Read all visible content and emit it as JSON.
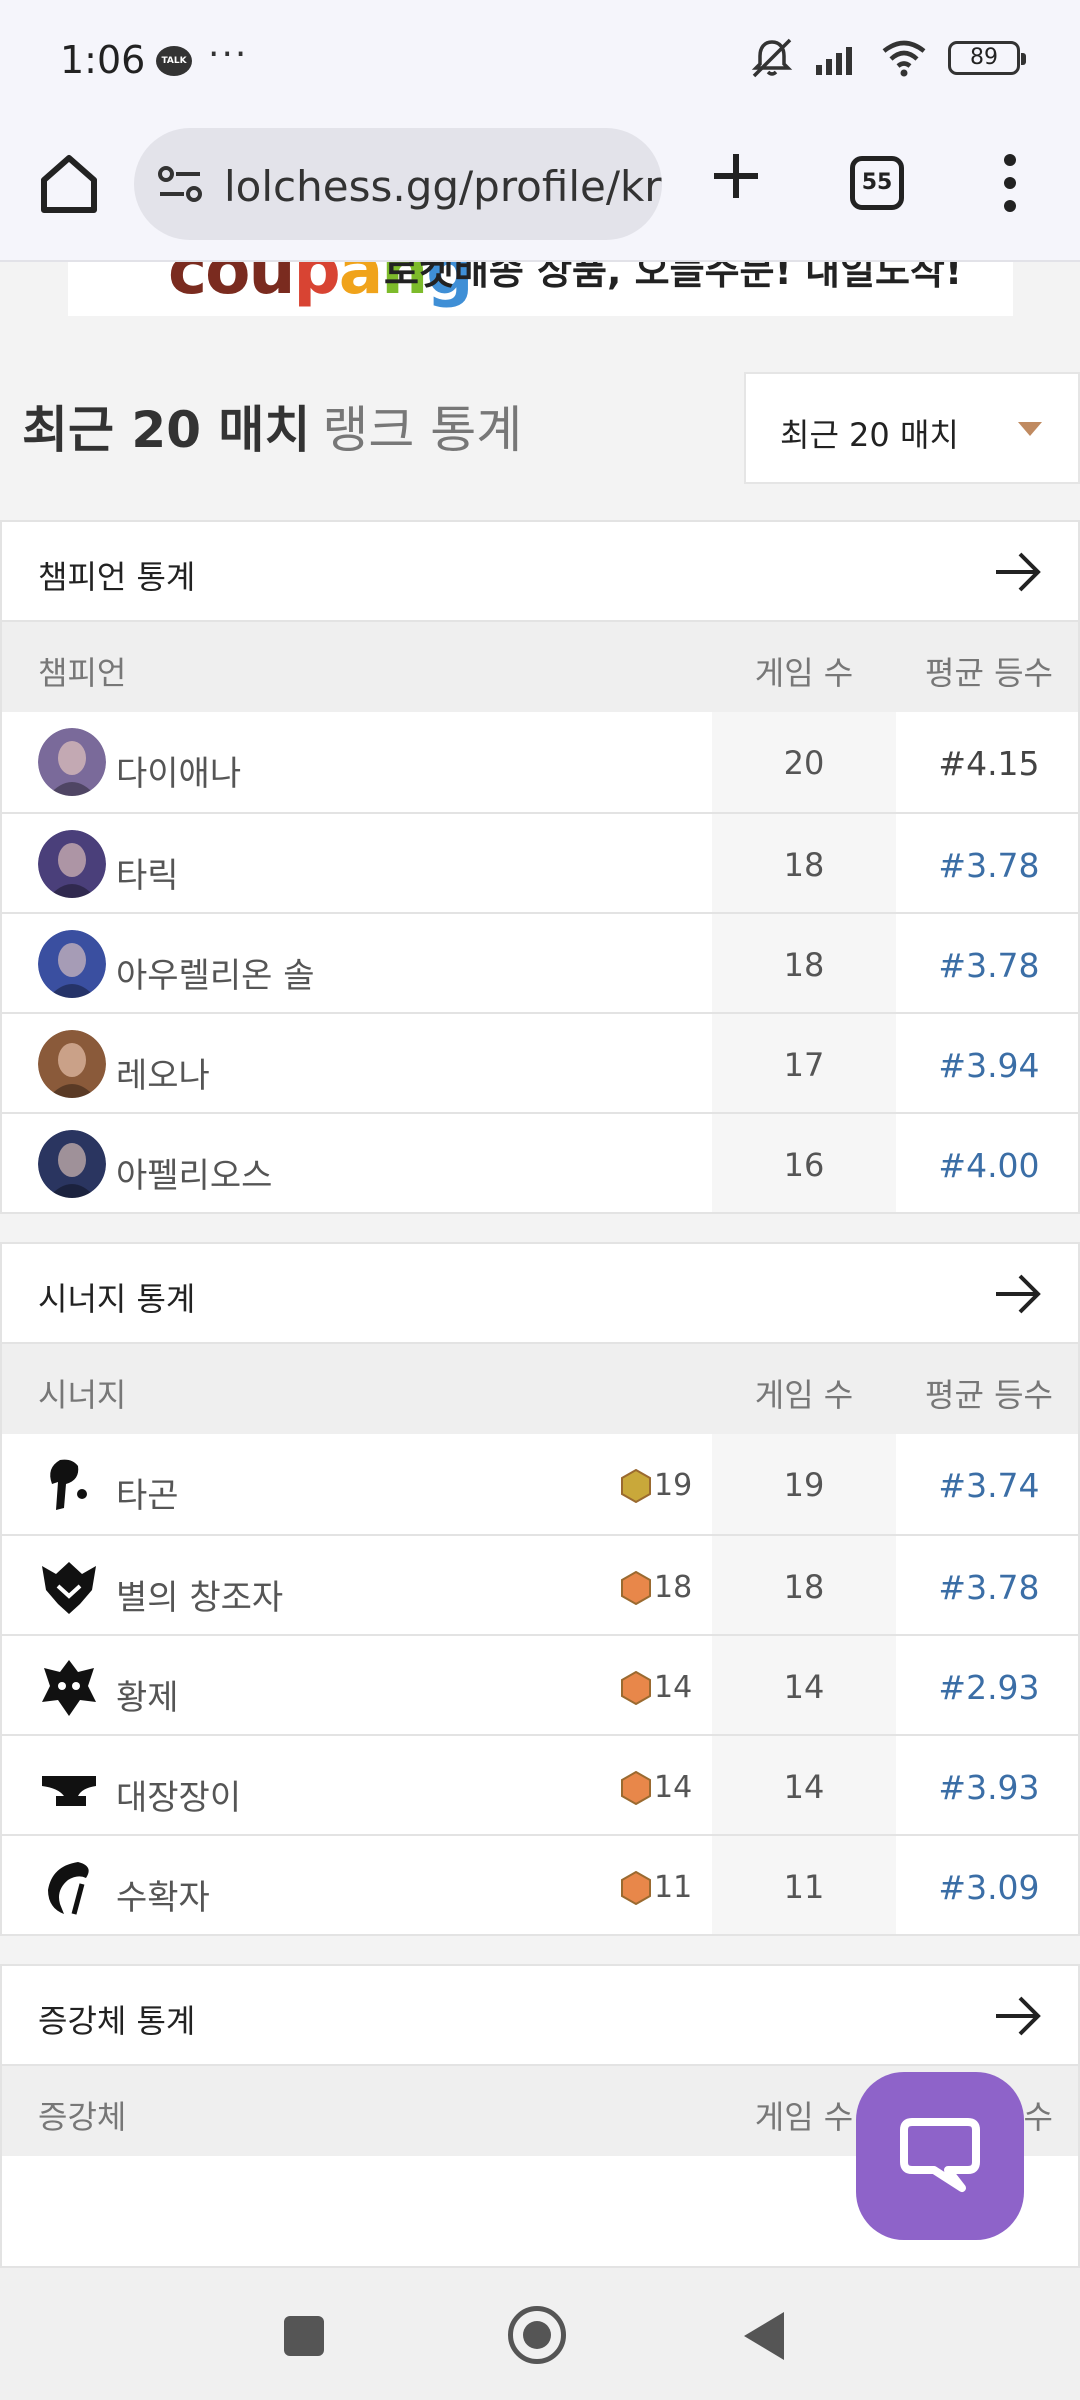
{
  "status_bar": {
    "time": "1:06",
    "talk_badge": "TALK",
    "more": "···",
    "battery": "89"
  },
  "browser": {
    "url": "lolchess.gg/profile/kr",
    "tab_count": "55"
  },
  "ad": {
    "brand": "coupang",
    "text": "로켓배송 상품, 오늘주문! 내일도착!"
  },
  "heading": {
    "title": "최근 20 매치",
    "subtitle": "랭크 통계"
  },
  "filter": {
    "selected": "최근 20 매치"
  },
  "champions": {
    "title": "챔피언 통계",
    "col_name": "챔피언",
    "col_games": "게임 수",
    "col_avg": "평균 등수",
    "rows": [
      {
        "name": "다이애나",
        "games": "20",
        "avg": "#4.15",
        "color": "#7a6a9a"
      },
      {
        "name": "타릭",
        "games": "18",
        "avg": "#3.78",
        "color": "#4a3f7a"
      },
      {
        "name": "아우렐리온 솔",
        "games": "18",
        "avg": "#3.78",
        "color": "#3a4fa0"
      },
      {
        "name": "레오나",
        "games": "17",
        "avg": "#3.94",
        "color": "#8a5a3a"
      },
      {
        "name": "아펠리오스",
        "games": "16",
        "avg": "#4.00",
        "color": "#2a3560"
      }
    ]
  },
  "traits": {
    "title": "시너지 통계",
    "col_name": "시너지",
    "col_games": "게임 수",
    "col_avg": "평균 등수",
    "rows": [
      {
        "name": "타곤",
        "badge": "19",
        "games": "19",
        "avg": "#3.74",
        "tier_color": "#c9a83a",
        "icon": "targon-icon"
      },
      {
        "name": "별의 창조자",
        "badge": "18",
        "games": "18",
        "avg": "#3.78",
        "tier_color": "#e8874a",
        "icon": "starforger-icon"
      },
      {
        "name": "황제",
        "badge": "14",
        "games": "14",
        "avg": "#2.93",
        "tier_color": "#e8874a",
        "icon": "emperor-icon"
      },
      {
        "name": "대장장이",
        "badge": "14",
        "games": "14",
        "avg": "#3.93",
        "tier_color": "#e8874a",
        "icon": "blacksmith-icon"
      },
      {
        "name": "수확자",
        "badge": "11",
        "games": "11",
        "avg": "#3.09",
        "tier_color": "#e8874a",
        "icon": "reaper-icon"
      }
    ]
  },
  "augments": {
    "title": "증강체 통계",
    "col_name": "증강체",
    "col_games": "게임 수",
    "col_avg": "평균 등수"
  }
}
